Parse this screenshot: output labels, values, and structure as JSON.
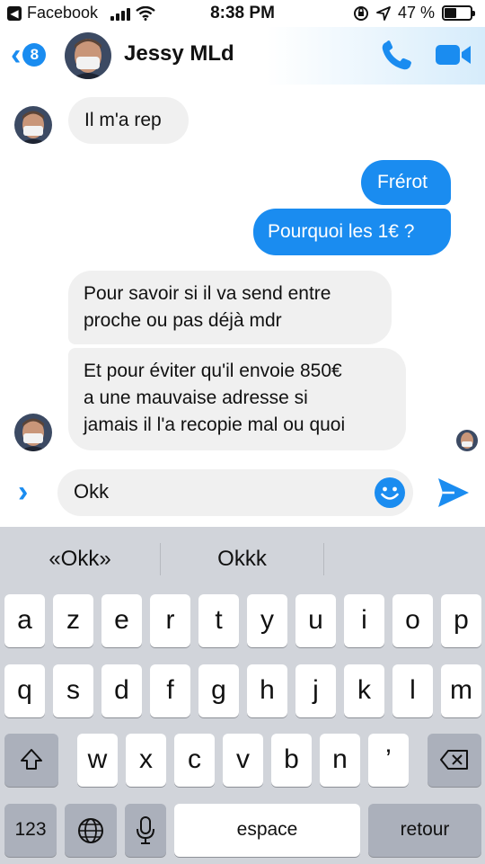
{
  "status_bar": {
    "back_app": "Facebook",
    "time": "8:38 PM",
    "battery_percent": "47 %",
    "battery_level": 0.47
  },
  "header": {
    "back_count": "8",
    "contact_name": "Jessy MLd"
  },
  "messages": [
    {
      "direction": "in",
      "lines": [
        "Il m'a rep"
      ]
    },
    {
      "direction": "out",
      "lines": [
        "Frérot"
      ]
    },
    {
      "direction": "out",
      "lines": [
        "Pourquoi les 1€ ?"
      ]
    },
    {
      "direction": "in",
      "lines": [
        "Pour savoir si il va send entre",
        "proche ou pas déjà mdr"
      ]
    },
    {
      "direction": "in",
      "lines": [
        "Et pour éviter qu'il envoie 850€",
        "a une mauvaise adresse si",
        "jamais il l'a recopie mal ou quoi"
      ]
    }
  ],
  "composer": {
    "text": "Okk"
  },
  "keyboard": {
    "suggestions": [
      "«Okk»",
      "Okkk",
      ""
    ],
    "row1": [
      "a",
      "z",
      "e",
      "r",
      "t",
      "y",
      "u",
      "i",
      "o",
      "p"
    ],
    "row2": [
      "q",
      "s",
      "d",
      "f",
      "g",
      "h",
      "j",
      "k",
      "l",
      "m"
    ],
    "row3": [
      "w",
      "x",
      "c",
      "v",
      "b",
      "n",
      "’"
    ],
    "numbers_label": "123",
    "space_label": "espace",
    "return_label": "retour"
  },
  "colors": {
    "accent": "#1a8cf0",
    "incoming_bubble": "#f0f0f0",
    "keyboard_bg": "#d1d4da"
  }
}
